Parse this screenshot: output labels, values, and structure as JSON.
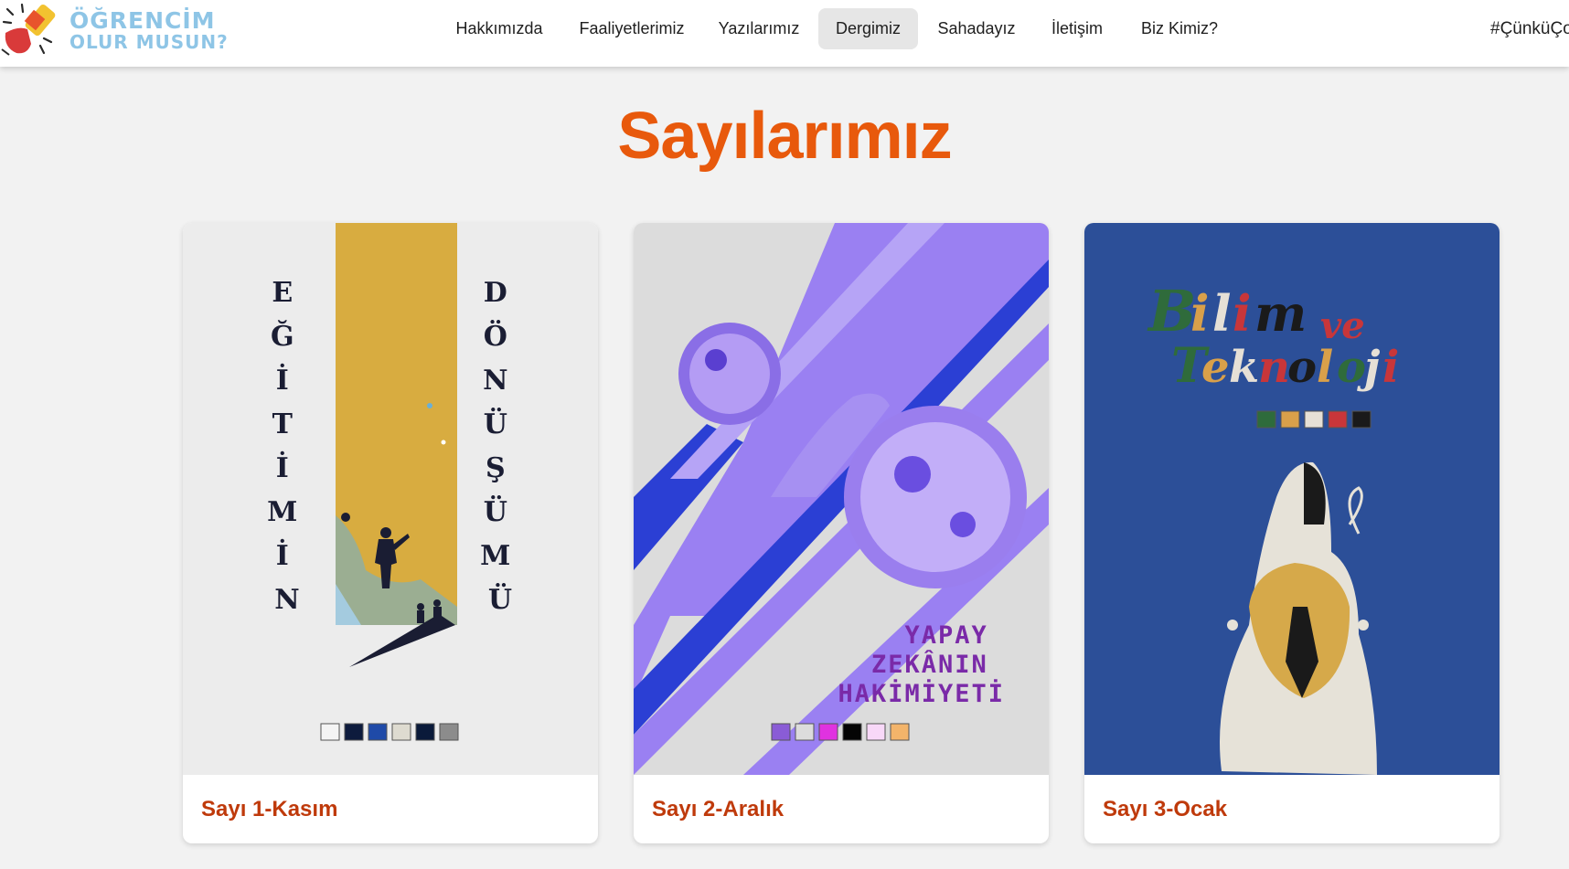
{
  "logo": {
    "line1": "ÖĞRENCİM",
    "line2": "OLUR MUSUN?"
  },
  "nav": {
    "items": [
      {
        "label": "Hakkımızda"
      },
      {
        "label": "Faaliyetlerimiz"
      },
      {
        "label": "Yazılarımız"
      },
      {
        "label": "Dergimiz",
        "active": true
      },
      {
        "label": "Sahadayız"
      },
      {
        "label": "İletişim"
      },
      {
        "label": "Biz Kimiz?"
      }
    ],
    "hashtag": "#ÇünküÇo"
  },
  "page": {
    "title": "Sayılarımız"
  },
  "issues": [
    {
      "label": "Sayı 1-Kasım",
      "cover": {
        "left_letters": [
          "E",
          "Ğ",
          "İ",
          "T",
          "İ",
          "M",
          "İ",
          "N"
        ],
        "right_letters": [
          "D",
          "Ö",
          "N",
          "Ü",
          "Ş",
          "Ü",
          "M",
          "Ü"
        ],
        "swatches": [
          "#f4f4f4",
          "#0d1b3d",
          "#1f4aa8",
          "#dedbd0",
          "#0a1a3a",
          "#8c8c8c"
        ]
      }
    },
    {
      "label": "Sayı 2-Aralık",
      "cover": {
        "lines": [
          "YAPAY",
          "ZEKÂNIN",
          "HAKİMİYETİ"
        ],
        "swatches": [
          "#8a5cd6",
          "#dcdcdc",
          "#e032e0",
          "#050505",
          "#f8d8f8",
          "#f3b46a"
        ]
      }
    },
    {
      "label": "Sayı 3-Ocak",
      "cover": {
        "swatches": [
          "#2e6b3c",
          "#d9a04a",
          "#e6e0d6",
          "#c8363a",
          "#1a1a1a"
        ]
      }
    }
  ],
  "colors": {
    "accent": "#e8590c",
    "label": "#bf3a0b",
    "logo": "#8ec5e6"
  }
}
